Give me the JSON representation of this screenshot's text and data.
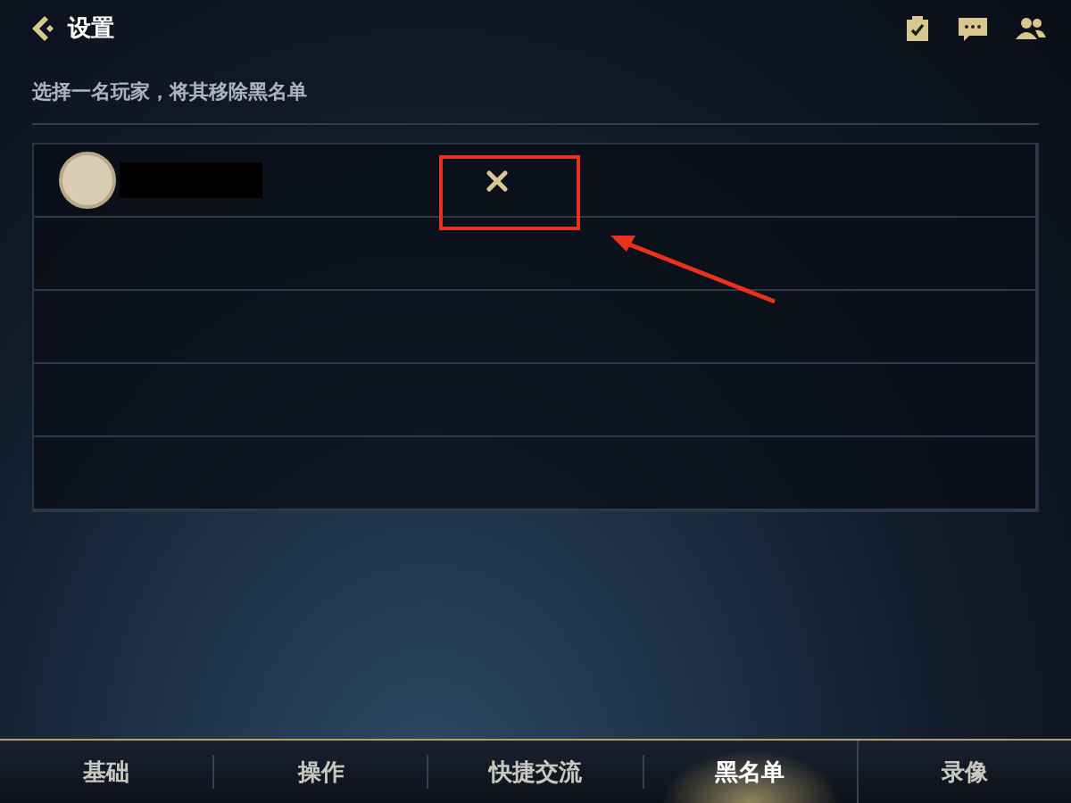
{
  "header": {
    "title": "设置"
  },
  "hint": "选择一名玩家，将其移除黑名单",
  "blacklist": {
    "rows": [
      {
        "kind": "player",
        "name_hidden": true
      },
      {
        "kind": "empty"
      },
      {
        "kind": "empty"
      },
      {
        "kind": "empty"
      },
      {
        "kind": "empty"
      }
    ]
  },
  "tabs": [
    {
      "label": "基础",
      "selected": false
    },
    {
      "label": "操作",
      "selected": false
    },
    {
      "label": "快捷交流",
      "selected": false
    },
    {
      "label": "黑名单",
      "selected": true
    },
    {
      "label": "录像",
      "selected": false
    }
  ]
}
